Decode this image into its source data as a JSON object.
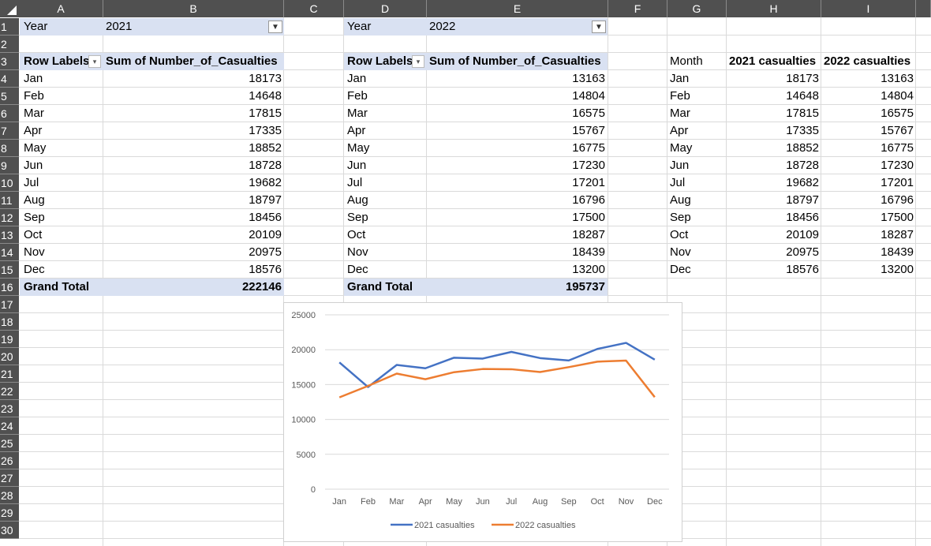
{
  "columns": [
    "A",
    "B",
    "C",
    "D",
    "E",
    "F",
    "G",
    "H",
    "I"
  ],
  "rows": [
    "1",
    "2",
    "3",
    "4",
    "5",
    "6",
    "7",
    "8",
    "9",
    "10",
    "11",
    "12",
    "13",
    "14",
    "15",
    "16",
    "17",
    "18",
    "19",
    "20",
    "21",
    "22",
    "23",
    "24",
    "25",
    "26",
    "27",
    "28",
    "29",
    "30"
  ],
  "pivot_2021": {
    "filter_label": "Year",
    "filter_value": "2021",
    "row_header": "Row Labels",
    "value_header": "Sum of Number_of_Casualties",
    "months": [
      "Jan",
      "Feb",
      "Mar",
      "Apr",
      "May",
      "Jun",
      "Jul",
      "Aug",
      "Sep",
      "Oct",
      "Nov",
      "Dec"
    ],
    "values": [
      "18173",
      "14648",
      "17815",
      "17335",
      "18852",
      "18728",
      "19682",
      "18797",
      "18456",
      "20109",
      "20975",
      "18576"
    ],
    "total_label": "Grand Total",
    "total_value": "222146"
  },
  "pivot_2022": {
    "filter_label": "Year",
    "filter_value": "2022",
    "row_header": "Row Labels",
    "value_header": "Sum of Number_of_Casualties",
    "months": [
      "Jan",
      "Feb",
      "Mar",
      "Apr",
      "May",
      "Jun",
      "Jul",
      "Aug",
      "Sep",
      "Oct",
      "Nov",
      "Dec"
    ],
    "values": [
      "13163",
      "14804",
      "16575",
      "15767",
      "16775",
      "17230",
      "17201",
      "16796",
      "17500",
      "18287",
      "18439",
      "13200"
    ],
    "total_label": "Grand Total",
    "total_value": "195737"
  },
  "summary_table": {
    "headers": [
      "Month",
      "2021 casualties",
      "2022 casualties"
    ],
    "rows": [
      [
        "Jan",
        "18173",
        "13163"
      ],
      [
        "Feb",
        "14648",
        "14804"
      ],
      [
        "Mar",
        "17815",
        "16575"
      ],
      [
        "Apr",
        "17335",
        "15767"
      ],
      [
        "May",
        "18852",
        "16775"
      ],
      [
        "Jun",
        "18728",
        "17230"
      ],
      [
        "Jul",
        "19682",
        "17201"
      ],
      [
        "Aug",
        "18797",
        "16796"
      ],
      [
        "Sep",
        "18456",
        "17500"
      ],
      [
        "Oct",
        "20109",
        "18287"
      ],
      [
        "Nov",
        "20975",
        "18439"
      ],
      [
        "Dec",
        "18576",
        "13200"
      ]
    ]
  },
  "icons": {
    "filter": "funnel-filter-icon",
    "dropdown": "dropdown-arrow-icon",
    "select_all": "select-all-triangle-icon"
  },
  "colors": {
    "header_bg": "#505050",
    "pivot_band": "#d9e1f2",
    "series_2021": "#4472c4",
    "series_2022": "#ed7d31"
  },
  "chart_data": {
    "type": "line",
    "categories": [
      "Jan",
      "Feb",
      "Mar",
      "Apr",
      "May",
      "Jun",
      "Jul",
      "Aug",
      "Sep",
      "Oct",
      "Nov",
      "Dec"
    ],
    "series": [
      {
        "name": "2021 casualties",
        "color": "#4472c4",
        "values": [
          18173,
          14648,
          17815,
          17335,
          18852,
          18728,
          19682,
          18797,
          18456,
          20109,
          20975,
          18576
        ]
      },
      {
        "name": "2022 casualties",
        "color": "#ed7d31",
        "values": [
          13163,
          14804,
          16575,
          15767,
          16775,
          17230,
          17201,
          16796,
          17500,
          18287,
          18439,
          13200
        ]
      }
    ],
    "yticks": [
      "0",
      "5000",
      "10000",
      "15000",
      "20000",
      "25000"
    ],
    "ylim": [
      0,
      25000
    ],
    "grid": true,
    "legend": "bottom"
  }
}
